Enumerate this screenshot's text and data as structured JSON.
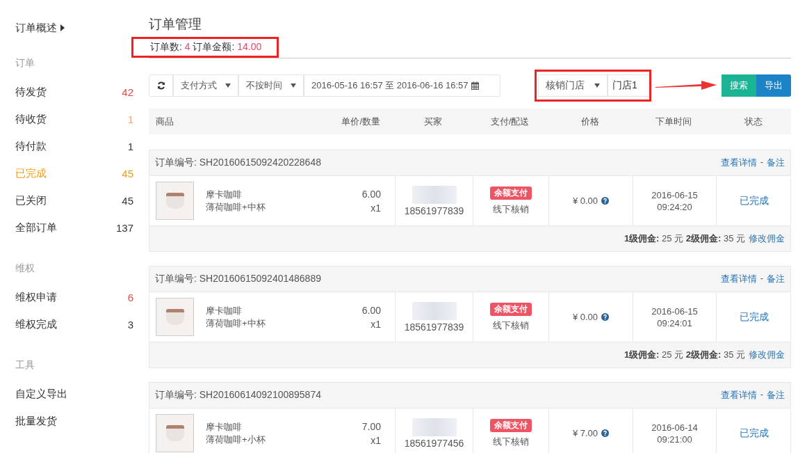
{
  "sidebar": {
    "overview": "订单概述",
    "groups": [
      {
        "title": "订单",
        "items": [
          {
            "label": "待发货",
            "count": "42",
            "color": "#ee4444",
            "selected": false
          },
          {
            "label": "待收货",
            "count": "1",
            "color": "#f9a36a",
            "selected": false
          },
          {
            "label": "待付款",
            "count": "1",
            "color": "#333333",
            "selected": false
          },
          {
            "label": "已完成",
            "count": "45",
            "color": "#f39c12",
            "selected": true
          },
          {
            "label": "已关闭",
            "count": "45",
            "color": "#333333",
            "selected": false
          },
          {
            "label": "全部订单",
            "count": "137",
            "color": "#333333",
            "selected": false
          }
        ]
      },
      {
        "title": "维权",
        "items": [
          {
            "label": "维权申请",
            "count": "6",
            "color": "#ee4444",
            "selected": false
          },
          {
            "label": "维权完成",
            "count": "3",
            "color": "#333333",
            "selected": false
          }
        ]
      },
      {
        "title": "工具",
        "items": [
          {
            "label": "自定义导出",
            "selected": false
          },
          {
            "label": "批量发货",
            "selected": false
          }
        ]
      }
    ]
  },
  "page_title": "订单管理",
  "summary": {
    "count_label": "订单数:",
    "count": "4",
    "amount_label": "订单金额:",
    "amount": "14.00"
  },
  "filters": {
    "payment": "支付方式",
    "time": "不按时间",
    "date_range": "2016-05-16 16:57 至 2016-06-16 16:57",
    "store_select": "核销门店",
    "store_value": "门店1",
    "search_button": "搜索",
    "export_button": "导出"
  },
  "table": {
    "columns": [
      "商品",
      "单价/数量",
      "买家",
      "支付/配送",
      "价格",
      "下单时间",
      "状态"
    ]
  },
  "orders": [
    {
      "number_label": "订单编号: SH20160615092420228648",
      "detail_link": "查看详情",
      "separator": "-",
      "note_link": "备注",
      "product": "摩卡咖啡",
      "spec": "薄荷咖啡+中杯",
      "price": "6.00",
      "qty": "x1",
      "phone": "18561977839",
      "payment": "余额支付",
      "delivery": "线下核销",
      "amount": "¥ 0.00",
      "date": "2016-06-15",
      "time": "09:24:20",
      "status": "已完成",
      "commission": {
        "level1_label": "1级佣金:",
        "level1": "25 元",
        "level2_label": "2级佣金:",
        "level2": "35 元",
        "edit_link": "修改佣金"
      }
    },
    {
      "number_label": "订单编号: SH20160615092401486889",
      "detail_link": "查看详情",
      "separator": "-",
      "note_link": "备注",
      "product": "摩卡咖啡",
      "spec": "薄荷咖啡+中杯",
      "price": "6.00",
      "qty": "x1",
      "phone": "18561977839",
      "payment": "余额支付",
      "delivery": "线下核销",
      "amount": "¥ 0.00",
      "date": "2016-06-15",
      "time": "09:24:01",
      "status": "已完成",
      "commission": {
        "level1_label": "1级佣金:",
        "level1": "25 元",
        "level2_label": "2级佣金:",
        "level2": "35 元",
        "edit_link": "修改佣金"
      }
    },
    {
      "number_label": "订单编号: SH20160614092100895874",
      "detail_link": "查看详情",
      "separator": "-",
      "note_link": "备注",
      "product": "摩卡咖啡",
      "spec": "薄荷咖啡+小杯",
      "price": "7.00",
      "qty": "x1",
      "phone": "18561977456",
      "payment": "余额支付",
      "delivery": "线下核销",
      "amount": "¥ 7.00",
      "date": "2016-06-14",
      "time": "09:21:00",
      "status": "已完成"
    }
  ]
}
